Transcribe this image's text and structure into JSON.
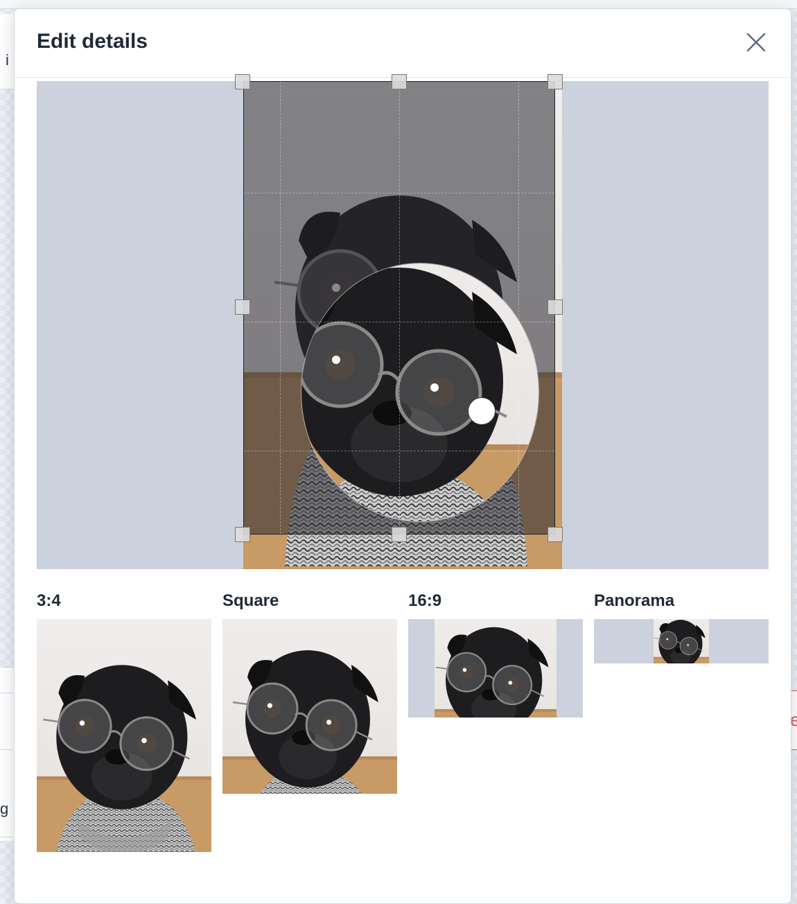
{
  "background": {
    "fragment_top": "i",
    "fragment_bottom": "g",
    "fragment_right": "e"
  },
  "modal": {
    "title": "Edit details",
    "close_icon": "close-icon"
  },
  "crop_editor": {
    "icons": [
      "resize-handle",
      "focal-point-handle"
    ]
  },
  "previews": [
    {
      "label": "3:4"
    },
    {
      "label": "Square"
    },
    {
      "label": "16:9"
    },
    {
      "label": "Panorama"
    }
  ],
  "colors": {
    "preview_background": "#cbd1dd",
    "text": "#1f2a37",
    "modal_background": "#ffffff"
  }
}
